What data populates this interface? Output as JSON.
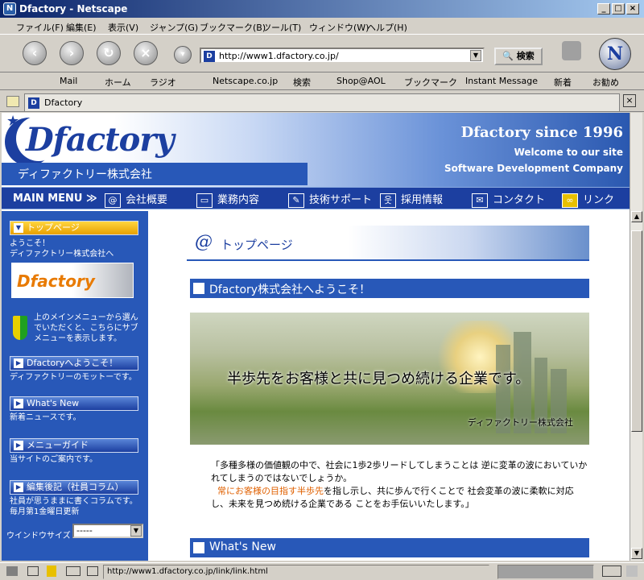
{
  "window": {
    "title": "Dfactory - Netscape"
  },
  "menubar": [
    "ファイル(F)",
    "編集(E)",
    "表示(V)",
    "ジャンプ(G)",
    "ブックマーク(B)",
    "ツール(T)",
    "ウィンドウ(W)",
    "ヘルプ(H)"
  ],
  "navigation": {
    "url": "http://www1.dfactory.co.jp/",
    "search_label": "検索"
  },
  "personal_toolbar": [
    "Mail",
    "ホーム",
    "ラジオ",
    "Netscape.co.jp",
    "検索",
    "Shop@AOL",
    "ブックマーク",
    "Instant Message",
    "新着",
    "お勧め"
  ],
  "tab": {
    "title": "Dfactory"
  },
  "site": {
    "logo": "Dfactory",
    "company_jp": "ディファクトリー株式会社",
    "since": "Dfactory since 1996",
    "welcome": "Welcome to our site",
    "tagline": "Software Development Company"
  },
  "main_menu": {
    "label": "MAIN MENU ≫",
    "items": [
      "会社概要",
      "業務内容",
      "技術サポート",
      "採用情報",
      "コンタクト",
      "リンク"
    ]
  },
  "sidebar": {
    "top_page": "トップページ",
    "welcome_text": "ようこそ！\nディファクトリー株式会社へ",
    "banner": "Dfactory",
    "menu_hint": "上のメインメニューから選んでいただくと、こちらにサブメニューを表示します。",
    "items": [
      {
        "label": "Dfactoryへようこそ！",
        "desc": "ディファクトリーのモットーです。"
      },
      {
        "label": "What's New",
        "desc": "新着ニュースです。"
      },
      {
        "label": "メニューガイド",
        "desc": "当サイトのご案内です。"
      },
      {
        "label": "編集後記（社員コラム）",
        "desc": "社員が思うままに書くコラムです。\n毎月第1金曜日更新"
      }
    ],
    "window_size_label": "ウインドウサイズ",
    "window_size_value": "-----"
  },
  "content": {
    "page_title": "トップページ",
    "welcome_heading": "Dfactory株式会社へようこそ！",
    "slogan": "半歩先をお客様と共に見つめ続ける企業です。",
    "hero_company": "ディファクトリー株式会社",
    "message_1": "「多種多様の価値観の中で、社会に1歩2歩リードしてしまうことは 逆に変革の波においていかれてしまうのではないでしょうか。",
    "message_red": "常にお客様の目指す半歩先",
    "message_2": "を指し示し、共に歩んで行くことで 社会変革の波に柔軟に対応し、未来を見つめ続ける企業である ことをお手伝いいたします。」",
    "whats_new_heading": "What's New"
  },
  "status": {
    "url": "http://www1.dfactory.co.jp/link/link.html"
  }
}
